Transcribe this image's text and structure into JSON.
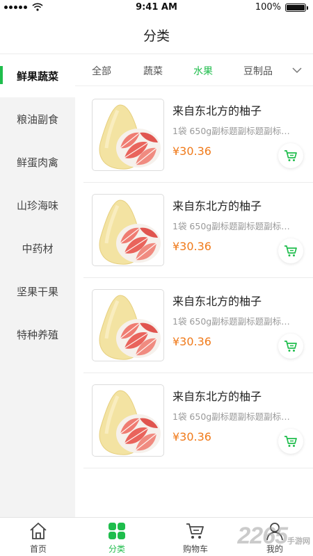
{
  "status_bar": {
    "time": "9:41 AM",
    "battery": "100%"
  },
  "nav": {
    "title": "分类"
  },
  "sidebar": {
    "items": [
      {
        "label": "鲜果蔬菜",
        "active": true
      },
      {
        "label": "粮油副食"
      },
      {
        "label": "鲜蛋肉禽"
      },
      {
        "label": "山珍海味"
      },
      {
        "label": "中药材"
      },
      {
        "label": "坚果干果"
      },
      {
        "label": "特种养殖"
      }
    ]
  },
  "tabs": {
    "items": [
      {
        "label": "全部"
      },
      {
        "label": "蔬菜"
      },
      {
        "label": "水果",
        "active": true
      },
      {
        "label": "豆制品"
      }
    ],
    "more_icon": "chevron-down-icon"
  },
  "products": [
    {
      "title": "来自东北方的柚子",
      "subtitle": "1袋 650g副标题副标题副标题副标题",
      "price": "¥30.36"
    },
    {
      "title": "来自东北方的柚子",
      "subtitle": "1袋 650g副标题副标题副标题副标题",
      "price": "¥30.36"
    },
    {
      "title": "来自东北方的柚子",
      "subtitle": "1袋 650g副标题副标题副标题副标题",
      "price": "¥30.36"
    },
    {
      "title": "来自东北方的柚子",
      "subtitle": "1袋 650g副标题副标题副标题副标题",
      "price": "¥30.36"
    }
  ],
  "tabbar": {
    "items": [
      {
        "label": "首页",
        "icon": "home-icon"
      },
      {
        "label": "分类",
        "icon": "category-grid-icon",
        "active": true
      },
      {
        "label": "购物车",
        "icon": "cart-icon"
      },
      {
        "label": "我的",
        "icon": "user-icon"
      }
    ]
  },
  "watermark": {
    "text": "2265",
    "subtext": "手游网"
  },
  "colors": {
    "accent": "#1fbd4c",
    "price": "#f07a1a",
    "sidebar_bg": "#f3f3f3"
  }
}
